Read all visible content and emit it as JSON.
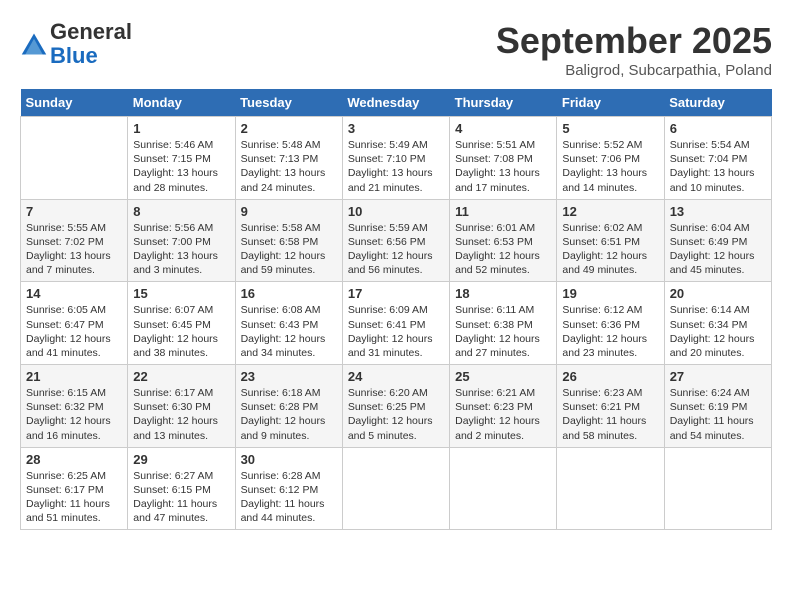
{
  "header": {
    "logo_line1": "General",
    "logo_line2": "Blue",
    "month_title": "September 2025",
    "subtitle": "Baligrod, Subcarpathia, Poland"
  },
  "days_of_week": [
    "Sunday",
    "Monday",
    "Tuesday",
    "Wednesday",
    "Thursday",
    "Friday",
    "Saturday"
  ],
  "weeks": [
    [
      {
        "day": "",
        "info": ""
      },
      {
        "day": "1",
        "info": "Sunrise: 5:46 AM\nSunset: 7:15 PM\nDaylight: 13 hours and 28 minutes."
      },
      {
        "day": "2",
        "info": "Sunrise: 5:48 AM\nSunset: 7:13 PM\nDaylight: 13 hours and 24 minutes."
      },
      {
        "day": "3",
        "info": "Sunrise: 5:49 AM\nSunset: 7:10 PM\nDaylight: 13 hours and 21 minutes."
      },
      {
        "day": "4",
        "info": "Sunrise: 5:51 AM\nSunset: 7:08 PM\nDaylight: 13 hours and 17 minutes."
      },
      {
        "day": "5",
        "info": "Sunrise: 5:52 AM\nSunset: 7:06 PM\nDaylight: 13 hours and 14 minutes."
      },
      {
        "day": "6",
        "info": "Sunrise: 5:54 AM\nSunset: 7:04 PM\nDaylight: 13 hours and 10 minutes."
      }
    ],
    [
      {
        "day": "7",
        "info": "Sunrise: 5:55 AM\nSunset: 7:02 PM\nDaylight: 13 hours and 7 minutes."
      },
      {
        "day": "8",
        "info": "Sunrise: 5:56 AM\nSunset: 7:00 PM\nDaylight: 13 hours and 3 minutes."
      },
      {
        "day": "9",
        "info": "Sunrise: 5:58 AM\nSunset: 6:58 PM\nDaylight: 12 hours and 59 minutes."
      },
      {
        "day": "10",
        "info": "Sunrise: 5:59 AM\nSunset: 6:56 PM\nDaylight: 12 hours and 56 minutes."
      },
      {
        "day": "11",
        "info": "Sunrise: 6:01 AM\nSunset: 6:53 PM\nDaylight: 12 hours and 52 minutes."
      },
      {
        "day": "12",
        "info": "Sunrise: 6:02 AM\nSunset: 6:51 PM\nDaylight: 12 hours and 49 minutes."
      },
      {
        "day": "13",
        "info": "Sunrise: 6:04 AM\nSunset: 6:49 PM\nDaylight: 12 hours and 45 minutes."
      }
    ],
    [
      {
        "day": "14",
        "info": "Sunrise: 6:05 AM\nSunset: 6:47 PM\nDaylight: 12 hours and 41 minutes."
      },
      {
        "day": "15",
        "info": "Sunrise: 6:07 AM\nSunset: 6:45 PM\nDaylight: 12 hours and 38 minutes."
      },
      {
        "day": "16",
        "info": "Sunrise: 6:08 AM\nSunset: 6:43 PM\nDaylight: 12 hours and 34 minutes."
      },
      {
        "day": "17",
        "info": "Sunrise: 6:09 AM\nSunset: 6:41 PM\nDaylight: 12 hours and 31 minutes."
      },
      {
        "day": "18",
        "info": "Sunrise: 6:11 AM\nSunset: 6:38 PM\nDaylight: 12 hours and 27 minutes."
      },
      {
        "day": "19",
        "info": "Sunrise: 6:12 AM\nSunset: 6:36 PM\nDaylight: 12 hours and 23 minutes."
      },
      {
        "day": "20",
        "info": "Sunrise: 6:14 AM\nSunset: 6:34 PM\nDaylight: 12 hours and 20 minutes."
      }
    ],
    [
      {
        "day": "21",
        "info": "Sunrise: 6:15 AM\nSunset: 6:32 PM\nDaylight: 12 hours and 16 minutes."
      },
      {
        "day": "22",
        "info": "Sunrise: 6:17 AM\nSunset: 6:30 PM\nDaylight: 12 hours and 13 minutes."
      },
      {
        "day": "23",
        "info": "Sunrise: 6:18 AM\nSunset: 6:28 PM\nDaylight: 12 hours and 9 minutes."
      },
      {
        "day": "24",
        "info": "Sunrise: 6:20 AM\nSunset: 6:25 PM\nDaylight: 12 hours and 5 minutes."
      },
      {
        "day": "25",
        "info": "Sunrise: 6:21 AM\nSunset: 6:23 PM\nDaylight: 12 hours and 2 minutes."
      },
      {
        "day": "26",
        "info": "Sunrise: 6:23 AM\nSunset: 6:21 PM\nDaylight: 11 hours and 58 minutes."
      },
      {
        "day": "27",
        "info": "Sunrise: 6:24 AM\nSunset: 6:19 PM\nDaylight: 11 hours and 54 minutes."
      }
    ],
    [
      {
        "day": "28",
        "info": "Sunrise: 6:25 AM\nSunset: 6:17 PM\nDaylight: 11 hours and 51 minutes."
      },
      {
        "day": "29",
        "info": "Sunrise: 6:27 AM\nSunset: 6:15 PM\nDaylight: 11 hours and 47 minutes."
      },
      {
        "day": "30",
        "info": "Sunrise: 6:28 AM\nSunset: 6:12 PM\nDaylight: 11 hours and 44 minutes."
      },
      {
        "day": "",
        "info": ""
      },
      {
        "day": "",
        "info": ""
      },
      {
        "day": "",
        "info": ""
      },
      {
        "day": "",
        "info": ""
      }
    ]
  ]
}
